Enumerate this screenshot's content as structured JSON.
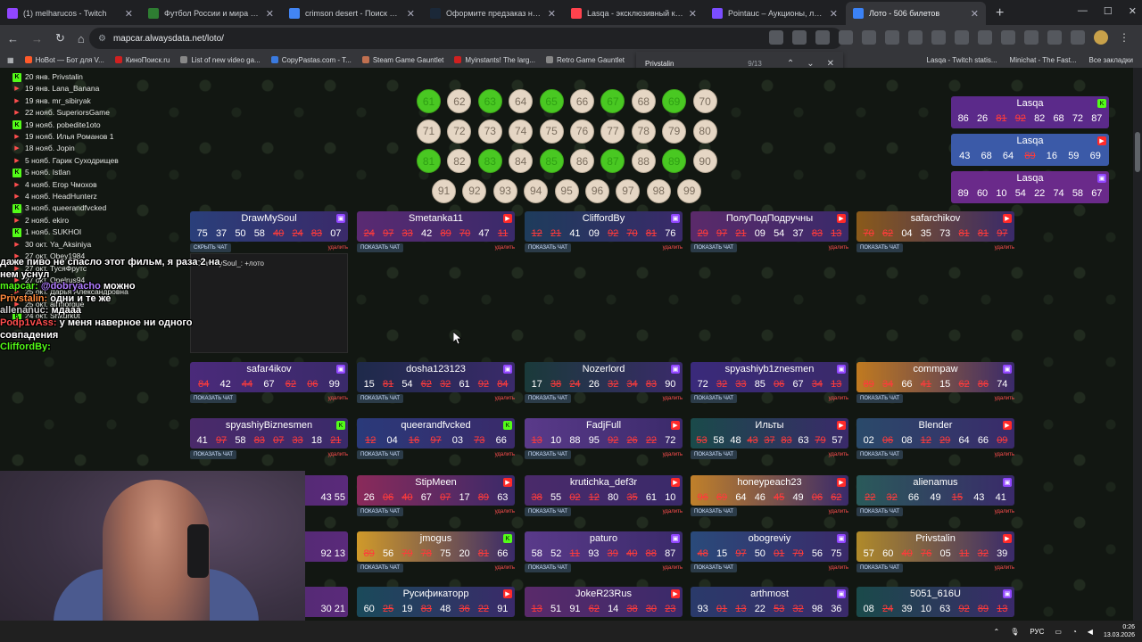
{
  "browser": {
    "tabs": [
      {
        "title": "(1) melharucos - Twitch",
        "color": "#9146ff"
      },
      {
        "title": "Футбол России и мира 2026 -",
        "color": "#2e7d32"
      },
      {
        "title": "crimson desert - Поиск в Goog",
        "color": "#4285f4"
      },
      {
        "title": "Оформите предзаказ на Crim",
        "color": "#1b2838"
      },
      {
        "title": "Lasqa - эксклюзивный контен",
        "color": "#ff424d"
      },
      {
        "title": "Pointauc – Аукционы, лотере",
        "color": "#7b4dff"
      },
      {
        "title": "Лото - 506 билетов",
        "color": "#3b82f6"
      }
    ],
    "new_tab": "+",
    "url": "mapcar.alwaysdata.net/loto/",
    "bookmarks": [
      "НоBot — Бот для V...",
      "КиноПоиск.ru",
      "List of new video ga...",
      "CopyPastas.com - T...",
      "Steam Game Gauntlet",
      "Myinstants! The larg...",
      "Retro Game Gauntlet"
    ],
    "bookmarks_right": [
      "Lasqa - Twitch statis...",
      "Minichat - The Fast...",
      "Все закладки"
    ],
    "find": {
      "query": "Privstalin",
      "count": "9/13"
    }
  },
  "winners": [
    {
      "date": "20 янв.",
      "name": "Privstalin",
      "p": "kick"
    },
    {
      "date": "19 янв.",
      "name": "Lana_Banana",
      "p": "yt"
    },
    {
      "date": "19 янв.",
      "name": "mr_sibiryak",
      "p": "yt"
    },
    {
      "date": "22 нояб.",
      "name": "SuperiorsGame",
      "p": "yt"
    },
    {
      "date": "19 нояб.",
      "name": "pobedite1oto",
      "p": "kick"
    },
    {
      "date": "19 нояб.",
      "name": "Илья Романов 1",
      "p": "yt"
    },
    {
      "date": "18 нояб.",
      "name": "Jopin",
      "p": "yt"
    },
    {
      "date": "5 нояб.",
      "name": "Гарик Суходрищев",
      "p": "yt"
    },
    {
      "date": "5 нояб.",
      "name": "Istlan",
      "p": "kick"
    },
    {
      "date": "4 нояб.",
      "name": "Егор Чмохов",
      "p": "yt"
    },
    {
      "date": "4 нояб.",
      "name": "HeadHunterz",
      "p": "yt"
    },
    {
      "date": "3 нояб.",
      "name": "queerandfvcked",
      "p": "kick"
    },
    {
      "date": "2 нояб.",
      "name": "ekiro",
      "p": "yt"
    },
    {
      "date": "1 нояб.",
      "name": "SUKHOI",
      "p": "kick"
    },
    {
      "date": "30 окт.",
      "name": "Ya_Aksiniya",
      "p": "yt"
    },
    {
      "date": "27 окт.",
      "name": "Obey1984",
      "p": "yt"
    },
    {
      "date": "27 окт.",
      "name": "ТусяФрутс",
      "p": "yt"
    },
    {
      "date": "27 окт.",
      "name": "Opelrus94",
      "p": "yt"
    },
    {
      "date": "25 окт.",
      "name": "Дарья Александровна",
      "p": "yt"
    },
    {
      "date": "25 окт.",
      "name": "airmorgue",
      "p": "yt"
    },
    {
      "date": "24 окт.",
      "name": "Shkurk0t",
      "p": "kick"
    }
  ],
  "balls": [
    {
      "n": "61",
      "hit": true
    },
    {
      "n": "62",
      "hit": false
    },
    {
      "n": "63",
      "hit": true
    },
    {
      "n": "64",
      "hit": false
    },
    {
      "n": "65",
      "hit": true
    },
    {
      "n": "66",
      "hit": false
    },
    {
      "n": "67",
      "hit": true
    },
    {
      "n": "68",
      "hit": false
    },
    {
      "n": "69",
      "hit": true
    },
    {
      "n": "70",
      "hit": false
    },
    {
      "n": "71",
      "hit": false
    },
    {
      "n": "72",
      "hit": false
    },
    {
      "n": "73",
      "hit": false
    },
    {
      "n": "74",
      "hit": false
    },
    {
      "n": "75",
      "hit": false
    },
    {
      "n": "76",
      "hit": false
    },
    {
      "n": "77",
      "hit": false
    },
    {
      "n": "78",
      "hit": false
    },
    {
      "n": "79",
      "hit": false
    },
    {
      "n": "80",
      "hit": false
    },
    {
      "n": "81",
      "hit": true
    },
    {
      "n": "82",
      "hit": false
    },
    {
      "n": "83",
      "hit": true
    },
    {
      "n": "84",
      "hit": false
    },
    {
      "n": "85",
      "hit": true
    },
    {
      "n": "86",
      "hit": false
    },
    {
      "n": "87",
      "hit": true
    },
    {
      "n": "88",
      "hit": false
    },
    {
      "n": "89",
      "hit": true
    },
    {
      "n": "90",
      "hit": false
    },
    {
      "n": "91",
      "hit": false
    },
    {
      "n": "92",
      "hit": false
    },
    {
      "n": "93",
      "hit": false
    },
    {
      "n": "94",
      "hit": false
    },
    {
      "n": "95",
      "hit": false
    },
    {
      "n": "96",
      "hit": false
    },
    {
      "n": "97",
      "hit": false
    },
    {
      "n": "98",
      "hit": false
    },
    {
      "n": "99",
      "hit": false
    }
  ],
  "labels": {
    "show_chat": "ПОКАЗАТЬ ЧАТ",
    "hide_chat": "СКРЫТЬ ЧАТ",
    "delete": "удалить"
  },
  "open_chat_message": "DrawMySoul_: +лото",
  "right_cards": [
    {
      "name": "Lasqa",
      "nums": [
        "86",
        "26",
        "81",
        "92",
        "82",
        "68",
        "72",
        "87"
      ],
      "hits": [
        2,
        3
      ],
      "bg": "#5b2a8a",
      "p": "kick"
    },
    {
      "name": "Lasqa",
      "nums": [
        "43",
        "68",
        "64",
        "89",
        "16",
        "59",
        "69",
        ""
      ],
      "hits": [
        3
      ],
      "bg": "#3b5aa8",
      "p": "yt"
    },
    {
      "name": "Lasqa",
      "nums": [
        "89",
        "60",
        "10",
        "54",
        "22",
        "74",
        "58",
        "67"
      ],
      "hits": [],
      "bg": "#6a2a8a",
      "p": "tw"
    }
  ],
  "cards": [
    {
      "name": "DrawMySoul",
      "nums": [
        "75",
        "37",
        "50",
        "58",
        "40",
        "24",
        "83",
        "07"
      ],
      "hits": [
        4,
        5,
        6
      ],
      "bg": "#2a3f7a",
      "p": "tw",
      "btn": "hide"
    },
    {
      "name": "Smetanka11",
      "nums": [
        "24",
        "97",
        "33",
        "42",
        "89",
        "70",
        "47",
        "11"
      ],
      "hits": [
        0,
        1,
        2,
        4,
        5,
        7
      ],
      "bg": "#5a2a72",
      "p": "yt",
      "btn": "show"
    },
    {
      "name": "CliffordBy",
      "nums": [
        "12",
        "21",
        "41",
        "09",
        "92",
        "70",
        "81",
        "76"
      ],
      "hits": [
        0,
        1,
        4,
        5,
        6
      ],
      "bg": "#1e3c5c",
      "p": "tw",
      "btn": "show"
    },
    {
      "name": "ПолуПодПодручны",
      "nums": [
        "29",
        "97",
        "21",
        "09",
        "54",
        "37",
        "83",
        "13"
      ],
      "hits": [
        0,
        1,
        2,
        6,
        7
      ],
      "bg": "#5b2a6a",
      "p": "yt",
      "btn": "show"
    },
    {
      "name": "safarchikov",
      "nums": [
        "70",
        "62",
        "04",
        "35",
        "73",
        "81",
        "81",
        "97"
      ],
      "hits": [
        0,
        1,
        5,
        6,
        7
      ],
      "bg": "#8a5a1a",
      "p": "yt",
      "btn": "show"
    },
    {
      "name": "safar4ikov",
      "nums": [
        "84",
        "42",
        "44",
        "67",
        "62",
        "06",
        "99",
        ""
      ],
      "hits": [
        0,
        2,
        4,
        5
      ],
      "bg": "#4a2a7a",
      "p": "tw",
      "btn": "show"
    },
    {
      "name": "dosha123123",
      "nums": [
        "15",
        "81",
        "54",
        "62",
        "32",
        "61",
        "92",
        "84"
      ],
      "hits": [
        1,
        3,
        4,
        6,
        7
      ],
      "bg": "#1e2a4a",
      "p": "tw",
      "btn": "show"
    },
    {
      "name": "Nozerlord",
      "nums": [
        "17",
        "38",
        "24",
        "26",
        "32",
        "34",
        "83",
        "90"
      ],
      "hits": [
        1,
        2,
        4,
        5,
        6
      ],
      "bg": "#1a3a3a",
      "p": "tw",
      "btn": "show"
    },
    {
      "name": "spyashiyb1znesmen",
      "nums": [
        "72",
        "32",
        "33",
        "85",
        "06",
        "67",
        "34",
        "13"
      ],
      "hits": [
        1,
        2,
        4,
        6,
        7
      ],
      "bg": "#3a2a7a",
      "p": "tw",
      "btn": "show"
    },
    {
      "name": "commpaw",
      "nums": [
        "89",
        "34",
        "66",
        "41",
        "15",
        "62",
        "86",
        "74"
      ],
      "hits": [
        0,
        1,
        3,
        5,
        6
      ],
      "bg": "#c07a20",
      "p": "tw",
      "btn": "show"
    },
    {
      "name": "spyashiyBiznesmen",
      "nums": [
        "41",
        "97",
        "58",
        "83",
        "07",
        "33",
        "18",
        "21"
      ],
      "hits": [
        1,
        3,
        4,
        5,
        7
      ],
      "bg": "#4a2a6a",
      "p": "kick",
      "btn": "show"
    },
    {
      "name": "queerandfvcked",
      "nums": [
        "12",
        "04",
        "16",
        "97",
        "03",
        "73",
        "66",
        ""
      ],
      "hits": [
        0,
        2,
        3,
        5
      ],
      "bg": "#2a3a7a",
      "p": "kick",
      "btn": "show"
    },
    {
      "name": "FadjFull",
      "nums": [
        "13",
        "10",
        "88",
        "95",
        "92",
        "26",
        "22",
        "72"
      ],
      "hits": [
        0,
        4,
        5,
        6
      ],
      "bg": "#5a3a8a",
      "p": "yt",
      "btn": "show"
    },
    {
      "name": "Ильты",
      "nums": [
        "53",
        "58",
        "48",
        "43",
        "37",
        "83",
        "63",
        "79",
        "57"
      ],
      "hits": [
        0,
        3,
        4,
        5,
        7
      ],
      "bg": "#1a4a4a",
      "p": "yt",
      "btn": "show"
    },
    {
      "name": "Blender",
      "nums": [
        "02",
        "06",
        "08",
        "12",
        "29",
        "64",
        "66",
        "09"
      ],
      "hits": [
        1,
        3,
        4,
        7
      ],
      "bg": "#2a4a6a",
      "p": "yt",
      "btn": "show"
    },
    {
      "name": "StipMeen",
      "nums": [
        "26",
        "06",
        "40",
        "67",
        "07",
        "17",
        "89",
        "63"
      ],
      "hits": [
        1,
        2,
        4,
        6
      ],
      "bg": "#8a2a5a",
      "p": "yt",
      "btn": "show"
    },
    {
      "name": "krutichka_def3r",
      "nums": [
        "38",
        "55",
        "02",
        "12",
        "80",
        "35",
        "61",
        "10"
      ],
      "hits": [
        0,
        2,
        3,
        5
      ],
      "bg": "#4a2a6a",
      "p": "yt",
      "btn": "show"
    },
    {
      "name": "honeypeach23",
      "nums": [
        "96",
        "69",
        "64",
        "46",
        "45",
        "49",
        "06",
        "62"
      ],
      "hits": [
        0,
        1,
        4,
        6,
        7
      ],
      "bg": "#c0802a",
      "p": "yt",
      "btn": "show"
    },
    {
      "name": "alienamus",
      "nums": [
        "22",
        "32",
        "66",
        "49",
        "15",
        "43",
        "41",
        ""
      ],
      "hits": [
        0,
        1,
        4
      ],
      "bg": "#2a5a5a",
      "p": "tw",
      "btn": "show"
    },
    {
      "name": "jmogus",
      "nums": [
        "89",
        "56",
        "79",
        "78",
        "75",
        "20",
        "81",
        "66"
      ],
      "hits": [
        0,
        2,
        3,
        6
      ],
      "bg": "#d09a2a",
      "p": "kick",
      "btn": "show"
    },
    {
      "name": "paturo",
      "nums": [
        "58",
        "52",
        "11",
        "93",
        "39",
        "40",
        "88",
        "87"
      ],
      "hits": [
        2,
        4,
        5,
        6
      ],
      "bg": "#5a3a8a",
      "p": "tw",
      "btn": "show"
    },
    {
      "name": "obogreviy",
      "nums": [
        "48",
        "15",
        "97",
        "50",
        "01",
        "79",
        "56",
        "75"
      ],
      "hits": [
        0,
        2,
        4,
        5
      ],
      "bg": "#2a4a7a",
      "p": "tw",
      "btn": "show"
    },
    {
      "name": "Privstalin",
      "nums": [
        "57",
        "60",
        "40",
        "76",
        "05",
        "11",
        "32",
        "39"
      ],
      "hits": [
        2,
        3,
        5,
        6
      ],
      "bg": "#b08a2a",
      "p": "yt",
      "btn": "show"
    },
    {
      "name": "Русификатoрр",
      "nums": [
        "60",
        "25",
        "19",
        "83",
        "48",
        "36",
        "22",
        "91"
      ],
      "hits": [
        1,
        3,
        5,
        6
      ],
      "bg": "#1a4a5a",
      "p": "yt",
      "btn": "show"
    },
    {
      "name": "JokeR23Rus",
      "nums": [
        "13",
        "51",
        "91",
        "62",
        "14",
        "38",
        "30",
        "23"
      ],
      "hits": [
        0,
        3,
        5,
        6,
        7
      ],
      "bg": "#5a2a6a",
      "p": "yt",
      "btn": "show"
    },
    {
      "name": "arthmost",
      "nums": [
        "93",
        "01",
        "13",
        "22",
        "53",
        "32",
        "98",
        "36"
      ],
      "hits": [
        1,
        2,
        4,
        5
      ],
      "bg": "#2a3a6a",
      "p": "tw",
      "btn": "show"
    },
    {
      "name": "5051_616U",
      "nums": [
        "08",
        "24",
        "39",
        "10",
        "63",
        "92",
        "89",
        "13"
      ],
      "hits": [
        1,
        5,
        6,
        7
      ],
      "bg": "#1a4a4a",
      "p": "tw",
      "btn": "show"
    }
  ],
  "partial_cards": [
    {
      "nums": "43  55"
    },
    {
      "nums": "92  13"
    },
    {
      "nums": "30  21"
    }
  ],
  "chat_overlay": [
    {
      "user": "",
      "text": "даже пиво не спасло этот фильм, я раза 2 на нем уснул",
      "color": "#ffffff"
    },
    {
      "user": "@dobryacho",
      "text": "можно",
      "color": "#b07cff",
      "prefix": "mapcar: "
    },
    {
      "user": "Privstalin:",
      "text": "одни и те же",
      "color": "#ff8a3d"
    },
    {
      "user": "allenanuc:",
      "text": "мдааа",
      "color": "#cccccc"
    },
    {
      "user": "Podp1vAss:",
      "text": "у меня наверное ни одного совпадения",
      "color": "#ff4e4e"
    },
    {
      "user": "CliffordBy:",
      "text": "",
      "color": "#53fc18"
    }
  ],
  "taskbar": {
    "lang": "РУС",
    "time": "0:26",
    "date": "13.03.2026"
  }
}
